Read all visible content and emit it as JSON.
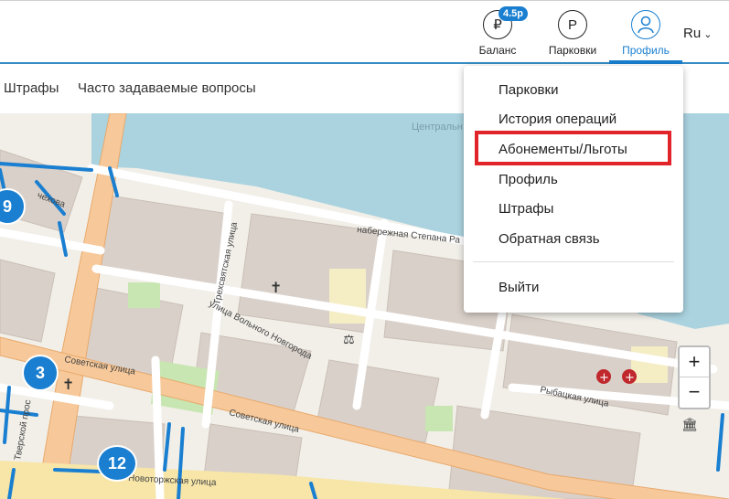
{
  "header": {
    "balance_label": "Баланс",
    "balance_badge": "4.5р",
    "balance_icon_char": "₽",
    "parkings_label": "Парковки",
    "parkings_icon_char": "P",
    "profile_label": "Профиль",
    "language": "Ru",
    "accent_color": "#1a7fd0"
  },
  "subnav": {
    "items": [
      "Штрафы",
      "Часто задаваемые вопросы"
    ]
  },
  "dropdown": {
    "items": [
      "Парковки",
      "История операций",
      "Абонементы/Льготы",
      "Профиль",
      "Штрафы",
      "Обратная связь"
    ],
    "logout": "Выйти",
    "highlight_color": "#e0242a"
  },
  "map": {
    "labels": {
      "central": "Центральн",
      "embankment": "набережная Степана Ра",
      "trekhsvyatskaya": "Трехсвятская улица",
      "volnogo": "улица Вольного Новгорода",
      "sovetskaya1": "Советская улица",
      "sovetskaya2": "Советская улица",
      "rybatskaya": "Рыбацкая улица",
      "tverskoy": "Тверской прос",
      "novotorzhskaya": "Новоторжская улица",
      "chekhova": "чехова"
    },
    "markers": [
      "9",
      "3",
      "12"
    ],
    "zoom_in": "+",
    "zoom_out": "−"
  }
}
